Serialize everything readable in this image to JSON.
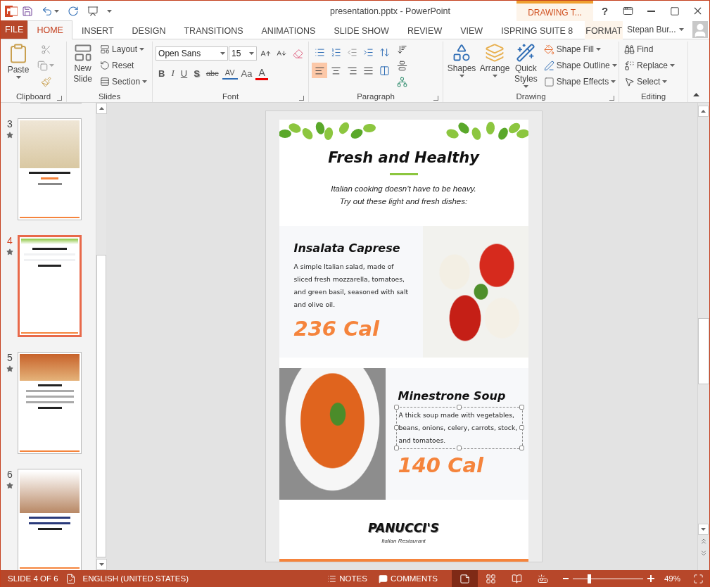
{
  "window": {
    "title": "presentation.pptx - PowerPoint",
    "help": "?"
  },
  "contextual_group": "DRAWING T...",
  "file_tab": "FILE",
  "tabs": [
    {
      "label": "HOME",
      "selected": true,
      "contextual": false
    },
    {
      "label": "INSERT",
      "selected": false,
      "contextual": false
    },
    {
      "label": "DESIGN",
      "selected": false,
      "contextual": false
    },
    {
      "label": "TRANSITIONS",
      "selected": false,
      "contextual": false
    },
    {
      "label": "ANIMATIONS",
      "selected": false,
      "contextual": false
    },
    {
      "label": "SLIDE SHOW",
      "selected": false,
      "contextual": false
    },
    {
      "label": "REVIEW",
      "selected": false,
      "contextual": false
    },
    {
      "label": "VIEW",
      "selected": false,
      "contextual": false
    },
    {
      "label": "ISPRING SUITE 8",
      "selected": false,
      "contextual": false
    },
    {
      "label": "FORMAT",
      "selected": false,
      "contextual": true
    }
  ],
  "account": "Stepan Bur...",
  "clipboard": {
    "label": "Clipboard",
    "paste": "Paste"
  },
  "slides_group": {
    "label": "Slides",
    "new_slide": "New Slide",
    "items": [
      {
        "label": "Layout",
        "kind": "layout",
        "dropdown": true
      },
      {
        "label": "Reset",
        "kind": "reset",
        "dropdown": false
      },
      {
        "label": "Section",
        "kind": "section",
        "dropdown": true
      }
    ]
  },
  "font": {
    "label": "Font",
    "family": "Open Sans",
    "size": "15",
    "format": [
      {
        "label": "B",
        "kind": "bold"
      },
      {
        "label": "I",
        "kind": "italic"
      },
      {
        "label": "U",
        "kind": "underline"
      },
      {
        "label": "S",
        "kind": "shadow"
      },
      {
        "label": "abc",
        "kind": "strike"
      },
      {
        "label": "AV",
        "kind": "spacing"
      },
      {
        "label": "Aa",
        "kind": "case"
      },
      {
        "label": "A",
        "kind": "color"
      }
    ]
  },
  "paragraph": {
    "label": "Paragraph",
    "alignments": [
      {
        "kind": "left",
        "selected": true
      },
      {
        "kind": "center",
        "selected": false
      },
      {
        "kind": "right",
        "selected": false
      },
      {
        "kind": "justify",
        "selected": false
      }
    ]
  },
  "drawing": {
    "label": "Drawing",
    "big": [
      {
        "label": "Shapes",
        "kind": "shapes"
      },
      {
        "label": "Arrange",
        "kind": "arrange"
      },
      {
        "label": "Quick Styles",
        "kind": "styles"
      }
    ],
    "small": [
      {
        "label": "Shape Fill",
        "kind": "fill"
      },
      {
        "label": "Shape Outline",
        "kind": "outline"
      },
      {
        "label": "Shape Effects",
        "kind": "effects"
      }
    ]
  },
  "editing": {
    "label": "Editing",
    "items": [
      {
        "label": "Find",
        "kind": "find",
        "dropdown": false
      },
      {
        "label": "Replace",
        "kind": "replace",
        "dropdown": true
      },
      {
        "label": "Select",
        "kind": "select",
        "dropdown": true
      }
    ]
  },
  "thumbnails": [
    {
      "number": "3",
      "selected": false,
      "kind": "dish"
    },
    {
      "number": "4",
      "selected": true,
      "kind": "dishes"
    },
    {
      "number": "5",
      "selected": false,
      "kind": "menu"
    },
    {
      "number": "6",
      "selected": false,
      "kind": "promo"
    }
  ],
  "slide": {
    "title": "Fresh and Healthy",
    "intro": [
      "Italian cooking doesn't have to be heavy.",
      "Try out these light and fresh dishes:"
    ],
    "dishes": [
      {
        "name": "Insalata Caprese",
        "description": "A simple Italian salad, made of sliced fresh mozzarella, tomatoes, and green basil, seasoned with salt and olive oil.",
        "calories": "236 Cal",
        "kind": "salad",
        "selected": false
      },
      {
        "name": "Minestrone Soup",
        "description": "A thick soup made with vegetables, beans, onions, celery, carrots, stock, and tomatoes.",
        "calories": "140 Cal",
        "kind": "soup",
        "selected": true
      }
    ],
    "brand": "PANUCCI'S",
    "tagline": "Italian Restaurant"
  },
  "status": {
    "slide": "SLIDE 4 OF 6",
    "language": "ENGLISH (UNITED STATES)",
    "notes": "NOTES",
    "comments": "COMMENTS",
    "views": [
      {
        "kind": "normal",
        "selected": true
      },
      {
        "kind": "sorter",
        "selected": false
      },
      {
        "kind": "reading",
        "selected": false
      },
      {
        "kind": "show",
        "selected": false
      }
    ],
    "zoom": {
      "level": 0.23,
      "reading": "49%"
    }
  }
}
